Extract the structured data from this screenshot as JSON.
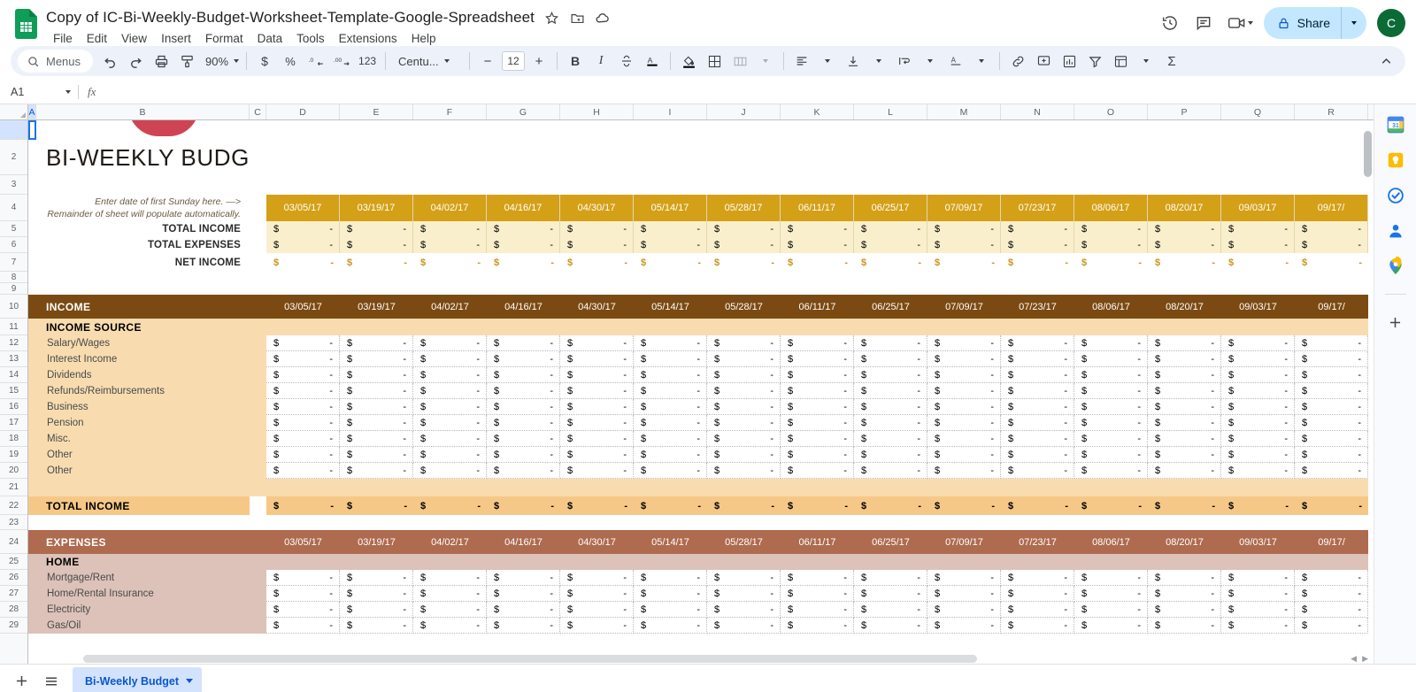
{
  "app": {
    "title": "Copy of IC-Bi-Weekly-Budget-Worksheet-Template-Google-Spreadsheet",
    "logo_name": "google-sheets-logo"
  },
  "menus": [
    "File",
    "Edit",
    "View",
    "Insert",
    "Format",
    "Data",
    "Tools",
    "Extensions",
    "Help"
  ],
  "title_icons": [
    "star-icon",
    "move-to-folder-icon",
    "cloud-saved-icon"
  ],
  "top_right": {
    "history_label": "Version history",
    "comment_label": "Open comment history",
    "meet_label": "Join a call",
    "share_label": "Share",
    "avatar_initial": "C"
  },
  "toolbar": {
    "menus_placeholder": "Menus",
    "undo": "Undo",
    "redo": "Redo",
    "print": "Print",
    "paint": "Paint format",
    "zoom_value": "90%",
    "currency": "$",
    "percent": "%",
    "decrease_decimal": ".0",
    "increase_decimal": ".00",
    "more_formats": "123",
    "font_name": "Centu...",
    "font_size": "12",
    "decrease_size": "−",
    "increase_size": "+",
    "bold": "B",
    "italic": "I",
    "strikethrough": "S",
    "text_color": "A",
    "fill_color": "Fill color",
    "borders": "Borders",
    "merge": "Merge cells",
    "halign": "Horizontal align",
    "valign": "Vertical align",
    "wrap": "Text wrapping",
    "rotate": "Text rotation",
    "link": "Insert link",
    "comment": "Insert comment",
    "chart": "Insert chart",
    "filter": "Create a filter",
    "functions": "Functions",
    "sigma": "Σ",
    "collapse": "Hide the menus"
  },
  "formula_bar": {
    "name_box": "A1",
    "fx": "fx",
    "value": ""
  },
  "grid": {
    "columns": [
      "A",
      "B",
      "C",
      "D",
      "E",
      "F",
      "G",
      "H",
      "I",
      "J",
      "K",
      "L",
      "M",
      "N",
      "O",
      "P",
      "Q",
      "R"
    ],
    "selected_column": "A",
    "selected_row": "1",
    "rows": [
      "1",
      "2",
      "3",
      "4",
      "5",
      "6",
      "7",
      "8",
      "9",
      "10",
      "11",
      "12",
      "13",
      "14",
      "15",
      "16",
      "17",
      "18",
      "19",
      "20",
      "21",
      "22",
      "23",
      "24",
      "25",
      "26",
      "27",
      "28"
    ]
  },
  "sheet_content": {
    "page_title": "BI-WEEKLY BUDGET",
    "instructions_line1": "Enter date of first Sunday here. —>",
    "instructions_line2": "Remainder of sheet will populate automatically.",
    "dates": [
      "03/05/17",
      "03/19/17",
      "04/02/17",
      "04/16/17",
      "04/30/17",
      "05/14/17",
      "05/28/17",
      "06/11/17",
      "06/25/17",
      "07/09/17",
      "07/23/17",
      "08/06/17",
      "08/20/17",
      "09/03/17",
      "09/17/"
    ],
    "currency_symbol": "$",
    "empty_value": "-",
    "summary": {
      "total_income_label": "TOTAL INCOME",
      "total_expenses_label": "TOTAL EXPENSES",
      "net_income_label": "NET INCOME"
    },
    "income": {
      "header": "INCOME",
      "subheader": "INCOME SOURCE",
      "sources": [
        "Salary/Wages",
        "Interest Income",
        "Dividends",
        "Refunds/Reimbursements",
        "Business",
        "Pension",
        "Misc.",
        "Other",
        "Other"
      ],
      "total_label": "TOTAL INCOME"
    },
    "expenses": {
      "header": "EXPENSES",
      "subheader": "HOME",
      "items": [
        "Mortgage/Rent",
        "Home/Rental Insurance",
        "Electricity",
        "Gas/Oil"
      ]
    }
  },
  "colors": {
    "gold_header": "#d4a017",
    "cream": "#faefcc",
    "peach": "#f8dcb0",
    "orange": "#f6c887",
    "income_brown": "#7b4a12",
    "expenses_terracotta": "#ae6b50",
    "home_rose": "#dcc2b9",
    "net_income_text": "#c9941a",
    "accent_blue": "#0b57d0",
    "share_bg": "#c2e7ff",
    "avatar_bg": "#0b6b35"
  },
  "bottom_bar": {
    "add_sheet": "Add Sheet",
    "all_sheets": "All Sheets",
    "active_tab": "Bi-Weekly Budget"
  },
  "side_rail": {
    "icons": [
      "calendar-icon",
      "keep-icon",
      "tasks-icon",
      "contacts-icon",
      "maps-icon",
      "add-apps-icon"
    ],
    "calendar_day": "31"
  }
}
